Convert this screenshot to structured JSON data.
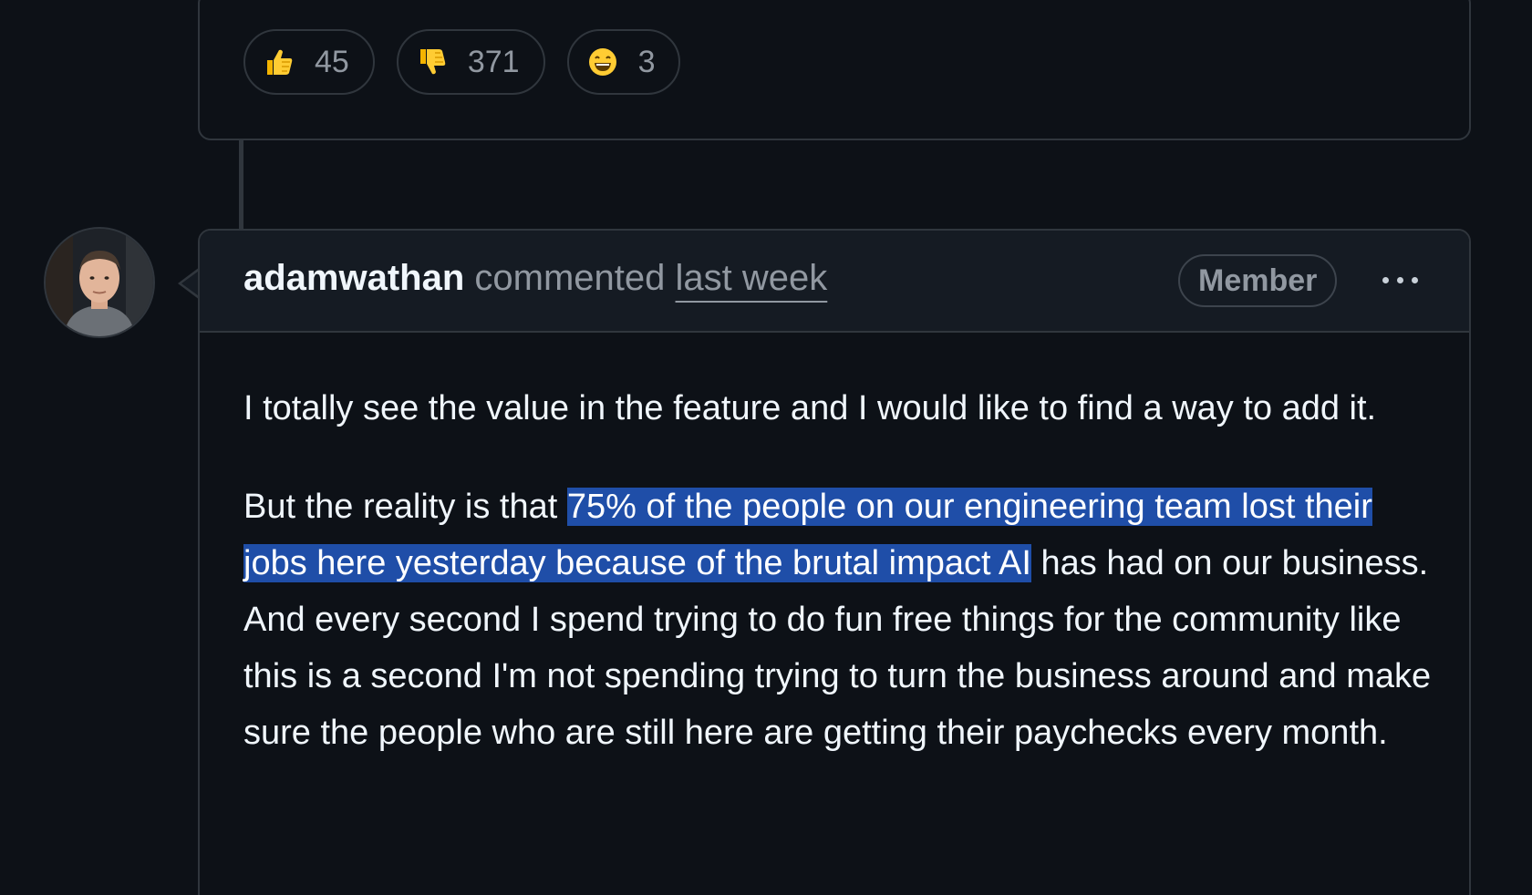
{
  "reactions": [
    {
      "icon": "thumbs-up-icon",
      "emoji": "👍",
      "count": "45"
    },
    {
      "icon": "thumbs-down-icon",
      "emoji": "👎",
      "count": "371"
    },
    {
      "icon": "smile-icon",
      "emoji": "😄",
      "count": "3"
    }
  ],
  "comment": {
    "author": "adamwathan",
    "action": "commented",
    "time": "last week",
    "badge": "Member",
    "menu_icon": "kebab-menu-icon",
    "paragraph1": "I totally see the value in the feature and I would like to find a way to add it.",
    "paragraph2_before": "But the reality is that ",
    "paragraph2_highlight": "75% of the people on our engineering team lost their jobs here yesterday because of the brutal impact AI",
    "paragraph2_after": " has had on our business. And every second I spend trying to do fun free things for the community like this is a second I'm not spending trying to turn the business around and make sure the people who are still here are getting their paychecks every month."
  },
  "colors": {
    "background": "#0d1117",
    "header_bg": "#151b23",
    "border": "#30363d",
    "muted_text": "#9198a1",
    "text": "#f0f6fc",
    "selection": "#1f4ea8"
  }
}
